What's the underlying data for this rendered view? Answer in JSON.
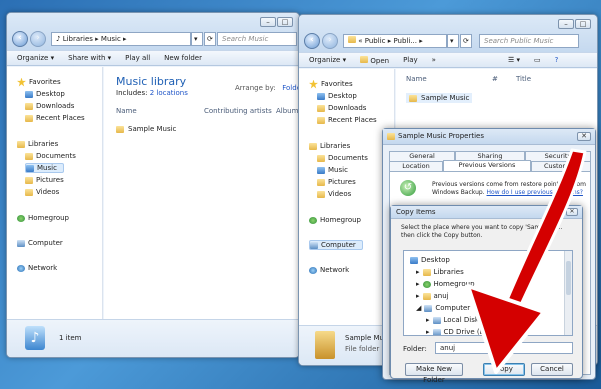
{
  "colors": {
    "accent": "#1e5fb4",
    "arrow": "#d40000",
    "link": "#1f55c7"
  },
  "win1": {
    "address": [
      "Libraries",
      "Music"
    ],
    "search_placeholder": "Search Music",
    "toolbar": [
      "Organize",
      "Share with",
      "Play all",
      "New folder"
    ],
    "nav": {
      "favorites": "Favorites",
      "desktop": "Desktop",
      "downloads": "Downloads",
      "recent": "Recent Places",
      "libraries": "Libraries",
      "documents": "Documents",
      "music": "Music",
      "pictures": "Pictures",
      "videos": "Videos",
      "homegroup": "Homegroup",
      "computer": "Computer",
      "network": "Network"
    },
    "library_title": "Music library",
    "includes_label": "Includes:",
    "includes_link": "2 locations",
    "arrange_label": "Arrange by:",
    "arrange_value": "Folder",
    "columns": [
      "Name",
      "Contributing artists",
      "Album"
    ],
    "items": [
      "Sample Music"
    ],
    "status": "1 item"
  },
  "win2": {
    "address_prefix": "«",
    "address": [
      "Public",
      "Publi..."
    ],
    "search_placeholder": "Search Public Music",
    "toolbar": [
      "Organize",
      "Open",
      "Play",
      "»"
    ],
    "columns": [
      "Name",
      "#",
      "Title"
    ],
    "items": [
      "Sample Music"
    ],
    "nav": {
      "favorites": "Favorites",
      "desktop": "Desktop",
      "downloads": "Downloads",
      "recent": "Recent Places",
      "libraries": "Libraries",
      "documents": "Documents",
      "music": "Music",
      "pictures": "Pictures",
      "videos": "Videos",
      "homegroup": "Homegroup",
      "computer": "Computer",
      "network": "Network"
    },
    "details_name": "Sample Music",
    "details_type": "File folder"
  },
  "props": {
    "title": "Sample Music Properties",
    "tabs_row1": [
      "General",
      "Sharing",
      "Security"
    ],
    "tabs_row2": [
      "Location",
      "Previous Versions",
      "Customize"
    ],
    "info_text1": "Previous versions come from restore points or from",
    "info_text2": "Windows Backup.",
    "info_link": "How do I use previous versions?"
  },
  "copy": {
    "title": "Copy Items",
    "instructions1": "Select the place where you want to copy 'Sample M...",
    "instructions2": "then click the Copy button.",
    "tree": [
      "Desktop",
      "Libraries",
      "Homegroup",
      "anuj",
      "Computer",
      "Local Disk (C:)",
      "CD Drive (D:)"
    ],
    "folder_label": "Folder:",
    "folder_value": "anuj",
    "buttons": {
      "new_folder": "Make New Folder",
      "copy": "Copy",
      "cancel": "Cancel"
    }
  }
}
